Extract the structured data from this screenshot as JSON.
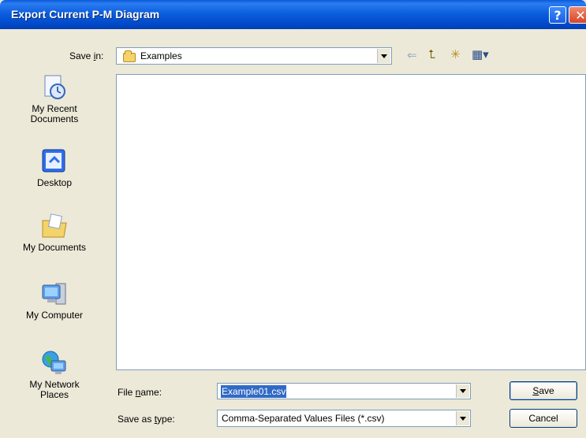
{
  "window": {
    "title": "Export Current P-M Diagram",
    "help_glyph": "?",
    "close_glyph": "✕"
  },
  "save_in": {
    "label_pre": "Save ",
    "label_key": "i",
    "label_post": "n:",
    "value": "Examples"
  },
  "toolbar": {
    "back_glyph": "⇐",
    "up_glyph": "⮤",
    "new_folder_glyph": "✳",
    "views_glyph": "▦▾"
  },
  "places": [
    {
      "label_line1": "My Recent",
      "label_line2": "Documents"
    },
    {
      "label_line1": "Desktop",
      "label_line2": ""
    },
    {
      "label_line1": "My Documents",
      "label_line2": ""
    },
    {
      "label_line1": "My Computer",
      "label_line2": ""
    },
    {
      "label_line1": "My Network",
      "label_line2": "Places"
    }
  ],
  "file_name": {
    "label_pre": "File ",
    "label_key": "n",
    "label_post": "ame:",
    "value": "Example01.csv"
  },
  "save_as_type": {
    "label_pre": "Save as ",
    "label_key": "t",
    "label_post": "ype:",
    "value": "Comma-Separated Values Files (*.csv)"
  },
  "buttons": {
    "save_key": "S",
    "save_rest": "ave",
    "cancel": "Cancel"
  },
  "colors": {
    "title_bar": "#0c5fe0",
    "dialog_bg": "#ece9d8",
    "selection": "#316ac5"
  }
}
